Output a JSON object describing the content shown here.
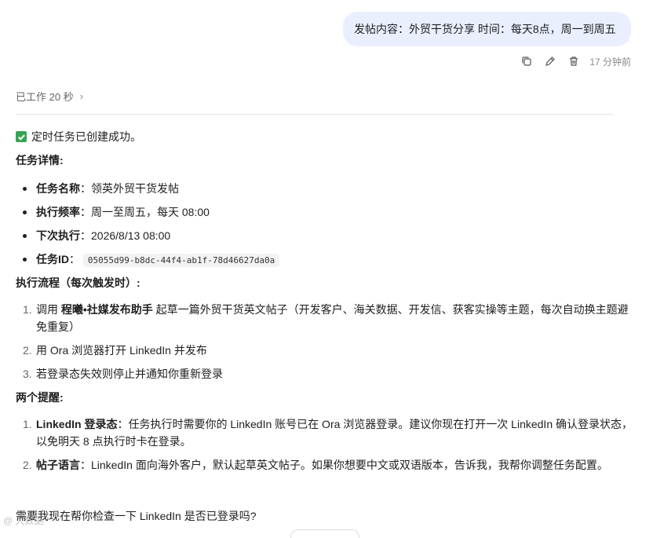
{
  "user_message": {
    "text": "发帖内容：外贸干货分享 时间：每天8点，周一到周五",
    "timestamp": "17 分钟前"
  },
  "actions": [
    {
      "icon": "copy-icon"
    },
    {
      "icon": "edit-icon"
    },
    {
      "icon": "trash-icon"
    }
  ],
  "worked": {
    "label": "已工作 20 秒",
    "chevron": "›"
  },
  "reply": {
    "success": "定时任务已创建成功。",
    "details_heading": "任务详情:",
    "details": [
      {
        "label": "任务名称",
        "value": "领英外贸干货发帖"
      },
      {
        "label": "执行频率",
        "value": "周一至周五，每天 08:00"
      },
      {
        "label": "下次执行",
        "value": "2026/8/13 08:00"
      },
      {
        "label": "任务ID",
        "value": "05055d99-b8dc-44f4-ab1f-78d46627da0a"
      }
    ],
    "flow_heading_bold": "执行流程",
    "flow_heading_rest": "（每次触发时）:",
    "flow": [
      {
        "num": "1.",
        "pre": "调用 ",
        "bold": "程曦•社媒发布助手",
        "post": " 起草一篇外贸干货英文帖子（开发客户、海关数据、开发信、获客实操等主题，每次自动换主题避免重复）"
      },
      {
        "num": "2.",
        "pre": "用 Ora 浏览器打开 LinkedIn 并发布",
        "bold": "",
        "post": ""
      },
      {
        "num": "3.",
        "pre": "若登录态失效则停止并通知你重新登录",
        "bold": "",
        "post": ""
      }
    ],
    "reminders_heading": "两个提醒:",
    "reminders": [
      {
        "num": "1.",
        "bold": "LinkedIn 登录态",
        "text": "：任务执行时需要你的 LinkedIn 账号已在 Ora 浏览器登录。建议你现在打开一次 LinkedIn 确认登录状态，以免明天 8 点执行时卡在登录。"
      },
      {
        "num": "2.",
        "bold": "帖子语言",
        "text": "：LinkedIn 面向海外客户，默认起草英文帖子。如果你想要中文或双语版本，告诉我，我帮你调整任务配置。"
      }
    ],
    "question": "需要我现在帮你检查一下 LinkedIn 是否已登录吗?"
  },
  "watermark": "@ 大数据"
}
